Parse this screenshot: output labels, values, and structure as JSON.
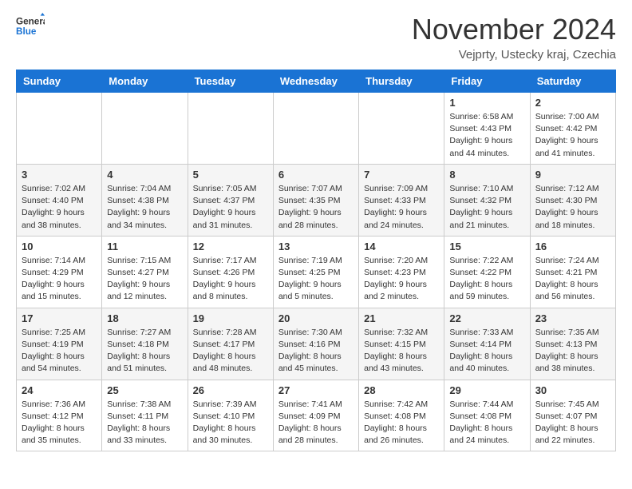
{
  "logo": {
    "general": "General",
    "blue": "Blue"
  },
  "title": "November 2024",
  "location": "Vejprty, Ustecky kraj, Czechia",
  "days_header": [
    "Sunday",
    "Monday",
    "Tuesday",
    "Wednesday",
    "Thursday",
    "Friday",
    "Saturday"
  ],
  "weeks": [
    [
      {
        "day": "",
        "info": ""
      },
      {
        "day": "",
        "info": ""
      },
      {
        "day": "",
        "info": ""
      },
      {
        "day": "",
        "info": ""
      },
      {
        "day": "",
        "info": ""
      },
      {
        "day": "1",
        "info": "Sunrise: 6:58 AM\nSunset: 4:43 PM\nDaylight: 9 hours and 44 minutes."
      },
      {
        "day": "2",
        "info": "Sunrise: 7:00 AM\nSunset: 4:42 PM\nDaylight: 9 hours and 41 minutes."
      }
    ],
    [
      {
        "day": "3",
        "info": "Sunrise: 7:02 AM\nSunset: 4:40 PM\nDaylight: 9 hours and 38 minutes."
      },
      {
        "day": "4",
        "info": "Sunrise: 7:04 AM\nSunset: 4:38 PM\nDaylight: 9 hours and 34 minutes."
      },
      {
        "day": "5",
        "info": "Sunrise: 7:05 AM\nSunset: 4:37 PM\nDaylight: 9 hours and 31 minutes."
      },
      {
        "day": "6",
        "info": "Sunrise: 7:07 AM\nSunset: 4:35 PM\nDaylight: 9 hours and 28 minutes."
      },
      {
        "day": "7",
        "info": "Sunrise: 7:09 AM\nSunset: 4:33 PM\nDaylight: 9 hours and 24 minutes."
      },
      {
        "day": "8",
        "info": "Sunrise: 7:10 AM\nSunset: 4:32 PM\nDaylight: 9 hours and 21 minutes."
      },
      {
        "day": "9",
        "info": "Sunrise: 7:12 AM\nSunset: 4:30 PM\nDaylight: 9 hours and 18 minutes."
      }
    ],
    [
      {
        "day": "10",
        "info": "Sunrise: 7:14 AM\nSunset: 4:29 PM\nDaylight: 9 hours and 15 minutes."
      },
      {
        "day": "11",
        "info": "Sunrise: 7:15 AM\nSunset: 4:27 PM\nDaylight: 9 hours and 12 minutes."
      },
      {
        "day": "12",
        "info": "Sunrise: 7:17 AM\nSunset: 4:26 PM\nDaylight: 9 hours and 8 minutes."
      },
      {
        "day": "13",
        "info": "Sunrise: 7:19 AM\nSunset: 4:25 PM\nDaylight: 9 hours and 5 minutes."
      },
      {
        "day": "14",
        "info": "Sunrise: 7:20 AM\nSunset: 4:23 PM\nDaylight: 9 hours and 2 minutes."
      },
      {
        "day": "15",
        "info": "Sunrise: 7:22 AM\nSunset: 4:22 PM\nDaylight: 8 hours and 59 minutes."
      },
      {
        "day": "16",
        "info": "Sunrise: 7:24 AM\nSunset: 4:21 PM\nDaylight: 8 hours and 56 minutes."
      }
    ],
    [
      {
        "day": "17",
        "info": "Sunrise: 7:25 AM\nSunset: 4:19 PM\nDaylight: 8 hours and 54 minutes."
      },
      {
        "day": "18",
        "info": "Sunrise: 7:27 AM\nSunset: 4:18 PM\nDaylight: 8 hours and 51 minutes."
      },
      {
        "day": "19",
        "info": "Sunrise: 7:28 AM\nSunset: 4:17 PM\nDaylight: 8 hours and 48 minutes."
      },
      {
        "day": "20",
        "info": "Sunrise: 7:30 AM\nSunset: 4:16 PM\nDaylight: 8 hours and 45 minutes."
      },
      {
        "day": "21",
        "info": "Sunrise: 7:32 AM\nSunset: 4:15 PM\nDaylight: 8 hours and 43 minutes."
      },
      {
        "day": "22",
        "info": "Sunrise: 7:33 AM\nSunset: 4:14 PM\nDaylight: 8 hours and 40 minutes."
      },
      {
        "day": "23",
        "info": "Sunrise: 7:35 AM\nSunset: 4:13 PM\nDaylight: 8 hours and 38 minutes."
      }
    ],
    [
      {
        "day": "24",
        "info": "Sunrise: 7:36 AM\nSunset: 4:12 PM\nDaylight: 8 hours and 35 minutes."
      },
      {
        "day": "25",
        "info": "Sunrise: 7:38 AM\nSunset: 4:11 PM\nDaylight: 8 hours and 33 minutes."
      },
      {
        "day": "26",
        "info": "Sunrise: 7:39 AM\nSunset: 4:10 PM\nDaylight: 8 hours and 30 minutes."
      },
      {
        "day": "27",
        "info": "Sunrise: 7:41 AM\nSunset: 4:09 PM\nDaylight: 8 hours and 28 minutes."
      },
      {
        "day": "28",
        "info": "Sunrise: 7:42 AM\nSunset: 4:08 PM\nDaylight: 8 hours and 26 minutes."
      },
      {
        "day": "29",
        "info": "Sunrise: 7:44 AM\nSunset: 4:08 PM\nDaylight: 8 hours and 24 minutes."
      },
      {
        "day": "30",
        "info": "Sunrise: 7:45 AM\nSunset: 4:07 PM\nDaylight: 8 hours and 22 minutes."
      }
    ]
  ]
}
